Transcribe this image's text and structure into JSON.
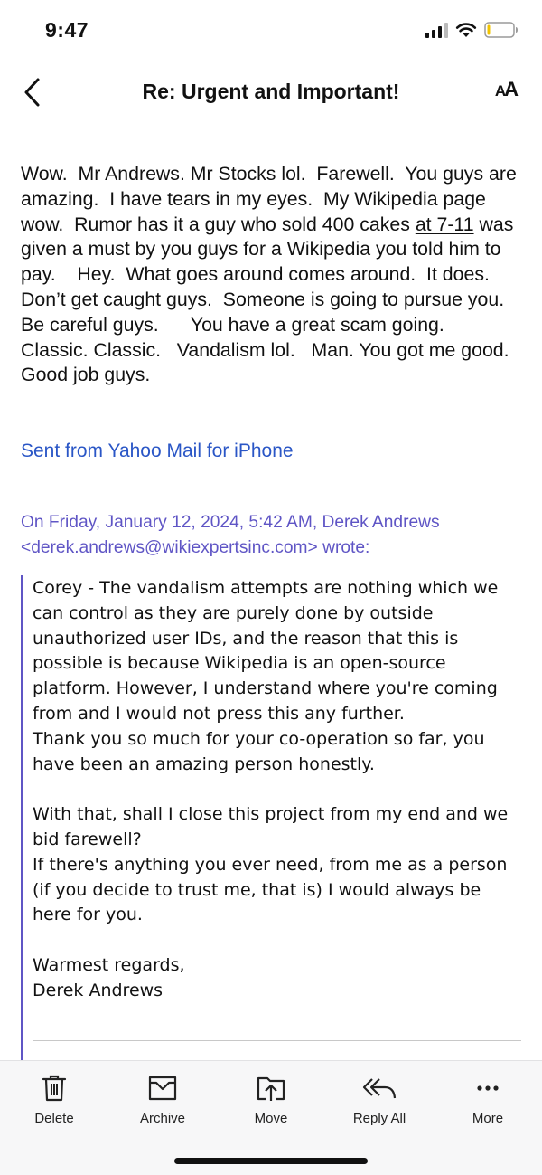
{
  "status_bar": {
    "time": "9:47"
  },
  "header": {
    "title": "Re: Urgent and Important!",
    "back_icon": "chevron-left-icon",
    "font_size_icon": "text-size-icon",
    "font_size_label_big": "A",
    "font_size_label_small": "A"
  },
  "message": {
    "body_before_underline": "Wow.  Mr Andrews. Mr Stocks lol.  Farewell.  You guys are amazing.  I have tears in my eyes.  My Wikipedia page wow.  Rumor has it a guy who sold 400 cakes ",
    "body_underlined": "at 7-11",
    "body_after_underline": " was given a must by you guys for a Wikipedia you told him to pay.    Hey.  What goes around comes around.  It does. Don’t get caught guys.  Someone is going to pursue you.   Be careful guys.      You have a great scam going.   Classic. Classic.   Vandalism lol.   Man. You got me good.  Good job guys.",
    "signature": "Sent from Yahoo Mail for iPhone"
  },
  "quote": {
    "header_prefix": "On Friday, January 12, 2024, 5:42 AM, Derek Andrews",
    "email": "<derek.andrews@wikiexpertsinc.com>",
    "header_suffix": " wrote:",
    "body": "Corey - The vandalism attempts are nothing which we can control as they are purely done by outside unauthorized user IDs, and the reason that this is possible is because Wikipedia is an open-source platform. However, I understand where you're coming from and I would not press this any further.\nThank you so much for your co-operation so far, you have been an amazing person honestly.\n\nWith that, shall I close this project from my end and we bid farewell?\nIf there's anything you ever need, from me as a person (if you decide to trust me, that is) I would always be here for you.\n\nWarmest regards,\nDerek Andrews",
    "accent_color": "#5f55c5"
  },
  "toolbar": {
    "delete": "Delete",
    "archive": "Archive",
    "move": "Move",
    "reply_all": "Reply All",
    "more": "More"
  },
  "colors": {
    "link_blue": "#2a56c6",
    "quote_purple": "#5f55c5",
    "toolbar_bg": "#f7f7f8"
  }
}
